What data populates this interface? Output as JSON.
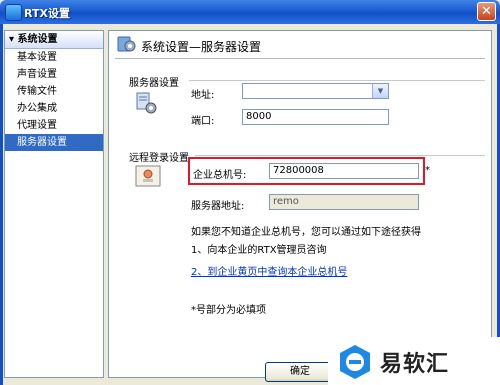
{
  "window": {
    "title": "RTX设置",
    "close_label": "✕"
  },
  "sidebar": {
    "group_label": "▾ 系统设置",
    "items": [
      {
        "label": "基本设置"
      },
      {
        "label": "声音设置"
      },
      {
        "label": "传输文件"
      },
      {
        "label": "办公集成"
      },
      {
        "label": "代理设置"
      },
      {
        "label": "服务器设置",
        "selected": true
      }
    ]
  },
  "panel": {
    "title": "系统设置—服务器设置",
    "server_section": {
      "heading": "服务器设置",
      "address_label": "地址:",
      "address_value": "",
      "port_label": "端口:",
      "port_value": "8000"
    },
    "remote_section": {
      "heading": "远程登录设置",
      "enterprise_label": "企业总机号:",
      "enterprise_value": "72800008",
      "required_mark": "*",
      "server_addr_label": "服务器地址:",
      "server_addr_value": "remo"
    },
    "help_text": "如果您不知道企业总机号，您可以通过如下途径获得",
    "help_item1": "1、向本企业的RTX管理员咨询",
    "help_item2_link": "2、到企业黄页中查询本企业总机号",
    "required_note": "*号部分为必填项"
  },
  "footer": {
    "ok_label": "确定"
  },
  "watermark": {
    "text": "易软汇"
  },
  "colors": {
    "title_blue": "#1150c8",
    "selection": "#316ac5",
    "highlight_red": "#e0182b",
    "link": "#0033cc"
  },
  "icons": [
    "app-icon",
    "settings-gear-icon",
    "server-gear-icon",
    "remote-login-icon",
    "dropdown-arrow-icon",
    "close-icon",
    "watermark-logo-icon"
  ]
}
